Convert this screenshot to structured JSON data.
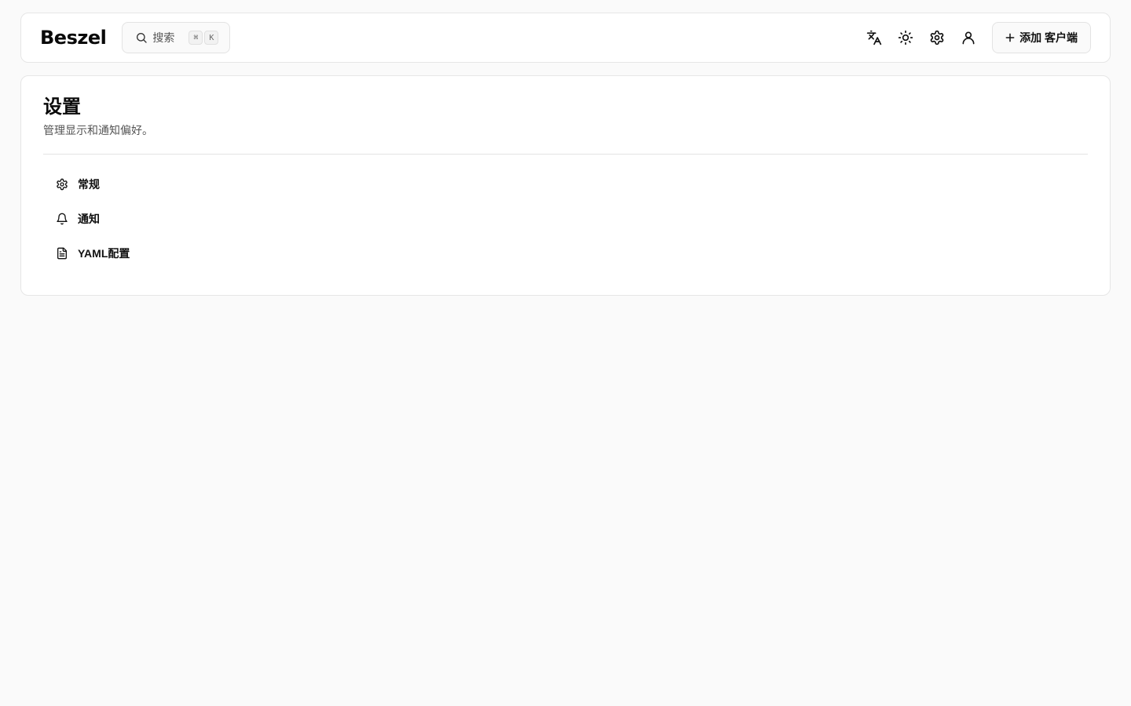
{
  "header": {
    "logo": "Beszel",
    "search": {
      "label": "搜索",
      "shortcut_mod": "⌘",
      "shortcut_key": "K"
    },
    "icons": [
      "translate-icon",
      "sun-icon",
      "gear-icon",
      "user-icon"
    ],
    "add_button_label": "添加 客户端"
  },
  "main": {
    "title": "设置",
    "subtitle": "管理显示和通知偏好。",
    "nav": [
      {
        "label": "常规",
        "icon": "gear-icon"
      },
      {
        "label": "通知",
        "icon": "bell-icon"
      },
      {
        "label": "YAML配置",
        "icon": "file-text-icon"
      }
    ]
  }
}
